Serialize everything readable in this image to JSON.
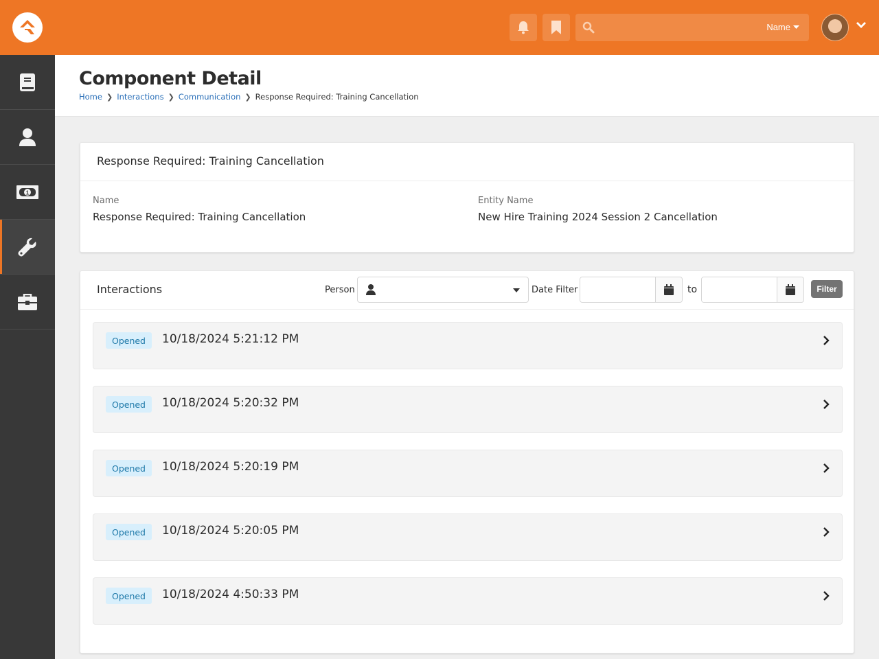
{
  "header": {
    "search_placeholder": "",
    "search_scope": "Name"
  },
  "sidebar": {
    "items": [
      {
        "name": "book",
        "active": false
      },
      {
        "name": "person",
        "active": false
      },
      {
        "name": "money",
        "active": false
      },
      {
        "name": "wrench",
        "active": true
      },
      {
        "name": "briefcase",
        "active": false
      }
    ]
  },
  "page": {
    "title": "Component Detail",
    "breadcrumb": [
      "Home",
      "Interactions",
      "Communication",
      "Response Required: Training Cancellation"
    ]
  },
  "details_panel": {
    "title": "Response Required: Training Cancellation",
    "fields": [
      {
        "label": "Name",
        "value": "Response Required: Training Cancellation"
      },
      {
        "label": "Entity Name",
        "value": "New Hire Training 2024 Session 2 Cancellation"
      }
    ]
  },
  "interactions_panel": {
    "title": "Interactions",
    "person_label": "Person",
    "person_value": "",
    "date_filter_label": "Date Filter",
    "date_from": "",
    "to_label": "to",
    "date_to": "",
    "filter_button": "Filter",
    "rows": [
      {
        "status": "Opened",
        "timestamp": "10/18/2024 5:21:12 PM"
      },
      {
        "status": "Opened",
        "timestamp": "10/18/2024 5:20:32 PM"
      },
      {
        "status": "Opened",
        "timestamp": "10/18/2024 5:20:19 PM"
      },
      {
        "status": "Opened",
        "timestamp": "10/18/2024 5:20:05 PM"
      },
      {
        "status": "Opened",
        "timestamp": "10/18/2024 4:50:33 PM"
      }
    ]
  },
  "colors": {
    "brand": "#ee7625",
    "sidebar": "#383838",
    "badge_bg": "#d8effc",
    "badge_text": "#1d78a8",
    "link": "#2a6fb8"
  }
}
